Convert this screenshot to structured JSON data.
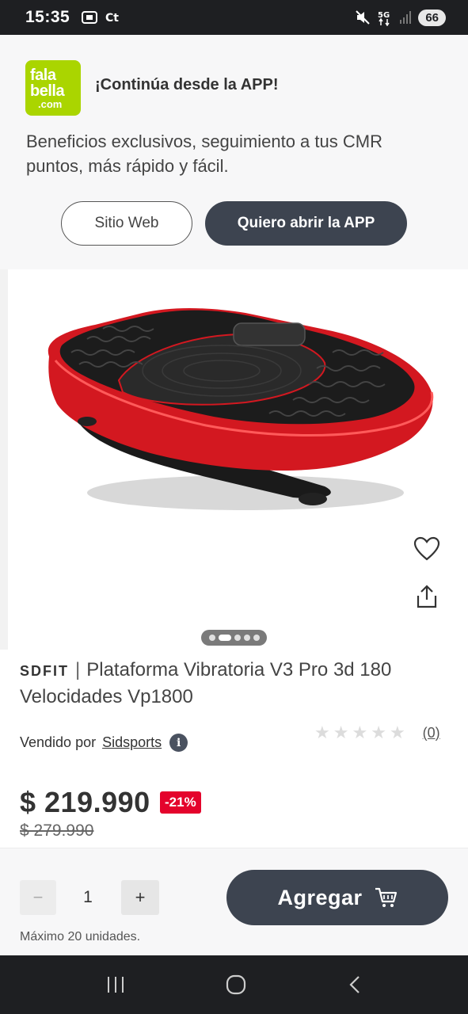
{
  "status_bar": {
    "time": "15:35",
    "battery": "66",
    "icons": [
      "screenshot-icon",
      "carrier-icon",
      "mute-icon",
      "5g-icon",
      "signal-icon"
    ]
  },
  "app_banner": {
    "logo": "falabella.com",
    "title": "¡Continúa desde la APP!",
    "description": "Beneficios exclusivos, seguimiento a tus CMR puntos, más rápido y fácil.",
    "web_button": "Sitio Web",
    "app_button": "Quiero abrir la APP",
    "accent_color": "#aad500"
  },
  "gallery": {
    "image_count": 5,
    "active_index": 0
  },
  "product": {
    "brand": "SDFIT",
    "separator": "|",
    "name": "Plataforma Vibratoria V3 Pro 3d 180 Velocidades Vp1800",
    "sold_by_label": "Vendido por",
    "seller": "Sidsports",
    "rating": 0,
    "review_count": "(0)",
    "price": "$ 219.990",
    "discount": "-21%",
    "old_price": "$ 279.990",
    "discount_color": "#e4032c"
  },
  "purchase": {
    "minus": "−",
    "quantity": "1",
    "plus": "+",
    "max_units": "Máximo 20 unidades.",
    "add_button": "Agregar",
    "button_color": "#3d4450"
  },
  "nav_bar": {
    "icons": [
      "recent-apps-icon",
      "home-icon",
      "back-icon"
    ]
  }
}
